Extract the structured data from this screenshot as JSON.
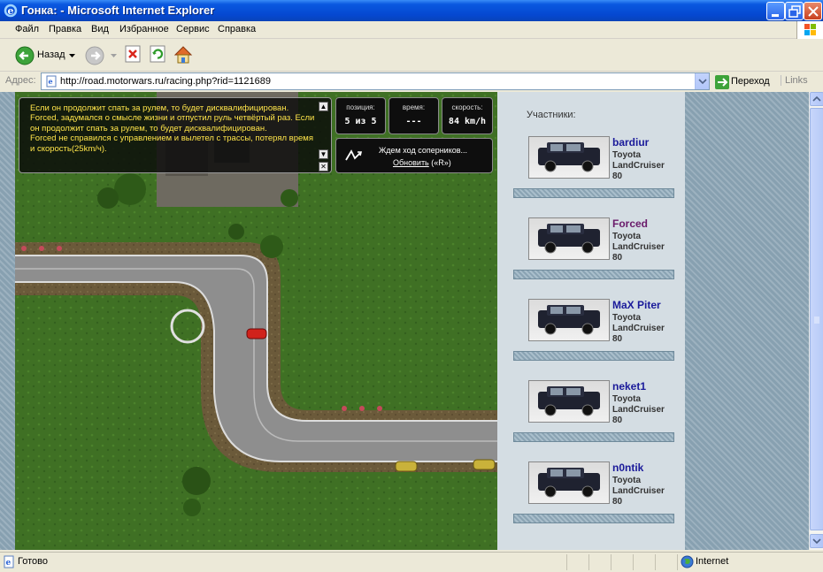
{
  "window": {
    "title": "Гонка: - Microsoft Internet Explorer"
  },
  "menu": [
    "Файл",
    "Правка",
    "Вид",
    "Избранное",
    "Сервис",
    "Справка"
  ],
  "toolbar": {
    "back_label": "Назад"
  },
  "address": {
    "label": "Адрес:",
    "url": "http://road.motorwars.ru/racing.php?rid=1121689",
    "go_label": "Переход",
    "links_label": "Links"
  },
  "game": {
    "log_lines": [
      "Если он продолжит спать за рулем, то будет дисквалифицирован.",
      "Forced, задумался о смысле жизни и отпустил руль четвёртый раз. Если он продолжит спать за рулем, то будет дисквалифицирован.",
      "Forced не справился с управлением и вылетел с трассы, потерял время и скорость(25km/ч)."
    ],
    "stats": {
      "position_caption": "позиция:",
      "position_value": "5 из 5",
      "time_caption": "время:",
      "time_value": "---",
      "speed_caption": "скорость:",
      "speed_value": "84 km/h"
    },
    "wait_message": "Ждем ход соперников...",
    "refresh_link": "Обновить",
    "refresh_hint": "(«R»)"
  },
  "participants": {
    "heading": "Участники:",
    "list": [
      {
        "name": "bardiur",
        "car": "Toyota LandCruiser 80",
        "color": "#1A1A9A"
      },
      {
        "name": "Forced",
        "car": "Toyota LandCruiser 80",
        "color": "#6A1A6A"
      },
      {
        "name": "MaX Piter",
        "car": "Toyota LandCruiser 80",
        "color": "#1A1A9A"
      },
      {
        "name": "neket1",
        "car": "Toyota LandCruiser 80",
        "color": "#1A1A9A"
      },
      {
        "name": "n0ntik",
        "car": "Toyota LandCruiser 80",
        "color": "#1A1A9A"
      }
    ]
  },
  "status": {
    "text": "Готово",
    "zone": "Internet"
  }
}
